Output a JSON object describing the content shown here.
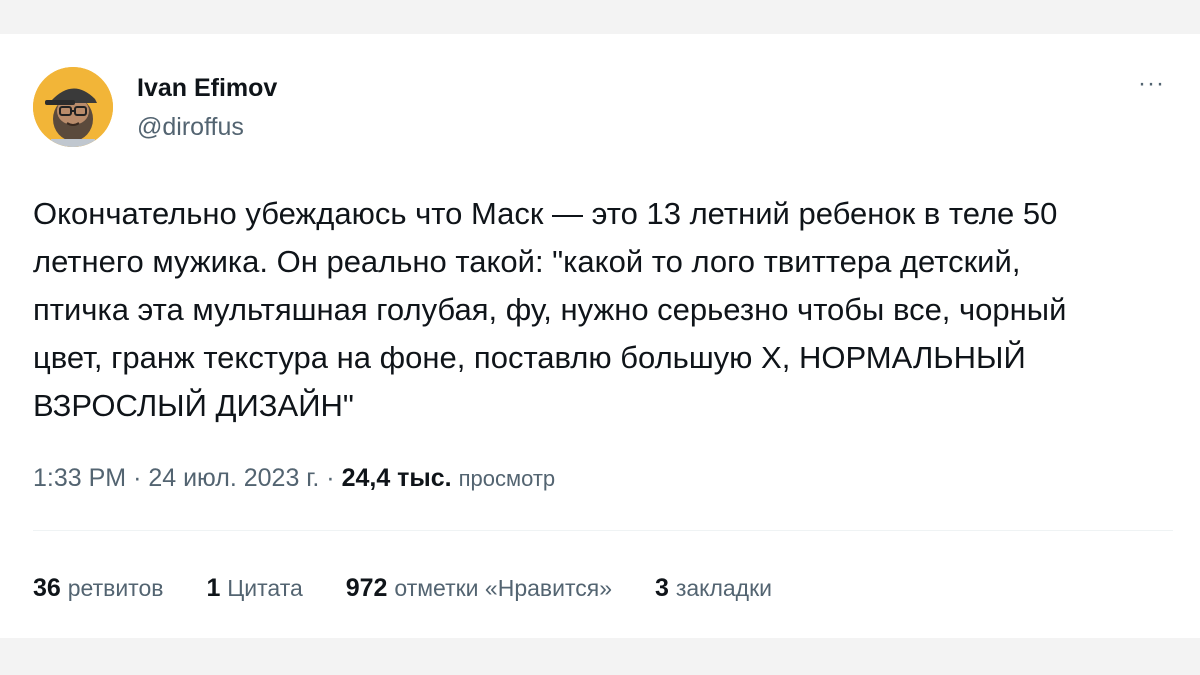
{
  "author": {
    "display_name": "Ivan Efimov",
    "handle": "@diroffus",
    "avatar_icon": "cartoon-bearded-man-avatar"
  },
  "more_icon": "more-horizontal-icon",
  "tweet": {
    "lines": [
      "Окончательно убеждаюсь что Маск — это 13 летний ребенок в теле 50",
      "летнего мужика. Он реально такой: \"какой то лого твиттера детский,",
      "птичка эта мультяшная голубая, фу, нужно серьезно чтобы все, чорный",
      "цвет, гранж текстура на фоне, поставлю большую X, НОРМАЛЬНЫЙ",
      "ВЗРОСЛЫЙ ДИЗАЙН\""
    ]
  },
  "meta": {
    "time": "1:33 PM",
    "separator": "·",
    "date": "24 июл. 2023 г.",
    "views_count": "24,4 тыс.",
    "views_label": "просмотр"
  },
  "stats": [
    {
      "num": "36",
      "label": "ретвитов"
    },
    {
      "num": "1",
      "label": "Цитата"
    },
    {
      "num": "972",
      "label": "отметки «Нравится»"
    },
    {
      "num": "3",
      "label": "закладки"
    }
  ],
  "colors": {
    "text_primary": "#0f1419",
    "text_secondary": "#536471",
    "avatar_bg": "#f2b538",
    "band_bg": "#f3f3f3"
  }
}
